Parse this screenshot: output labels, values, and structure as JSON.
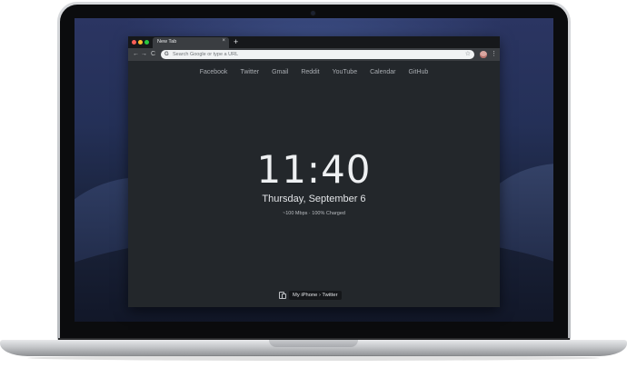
{
  "browser": {
    "tab_title": "New Tab",
    "tab_close": "×",
    "new_tab": "+",
    "nav": {
      "back": "←",
      "forward": "→",
      "reload": "C"
    },
    "omnibox": {
      "placeholder": "Search Google or type a URL",
      "google_glyph": "G"
    },
    "star": "☆",
    "menu": "⋮"
  },
  "newtab": {
    "links": [
      "Facebook",
      "Twitter",
      "Gmail",
      "Reddit",
      "YouTube",
      "Calendar",
      "GitHub"
    ],
    "time": "11:40",
    "date": "Thursday, September 6",
    "status": "~100 Mbps · 100% Charged",
    "handoff": "My iPhone › Twitter"
  },
  "colors": {
    "window_bg": "#23272b",
    "tabstrip_bg": "#16181b",
    "toolbar_bg": "#3a3d41",
    "traffic_close": "#fc5f57",
    "traffic_min": "#fdbc2e",
    "traffic_max": "#28c840"
  }
}
